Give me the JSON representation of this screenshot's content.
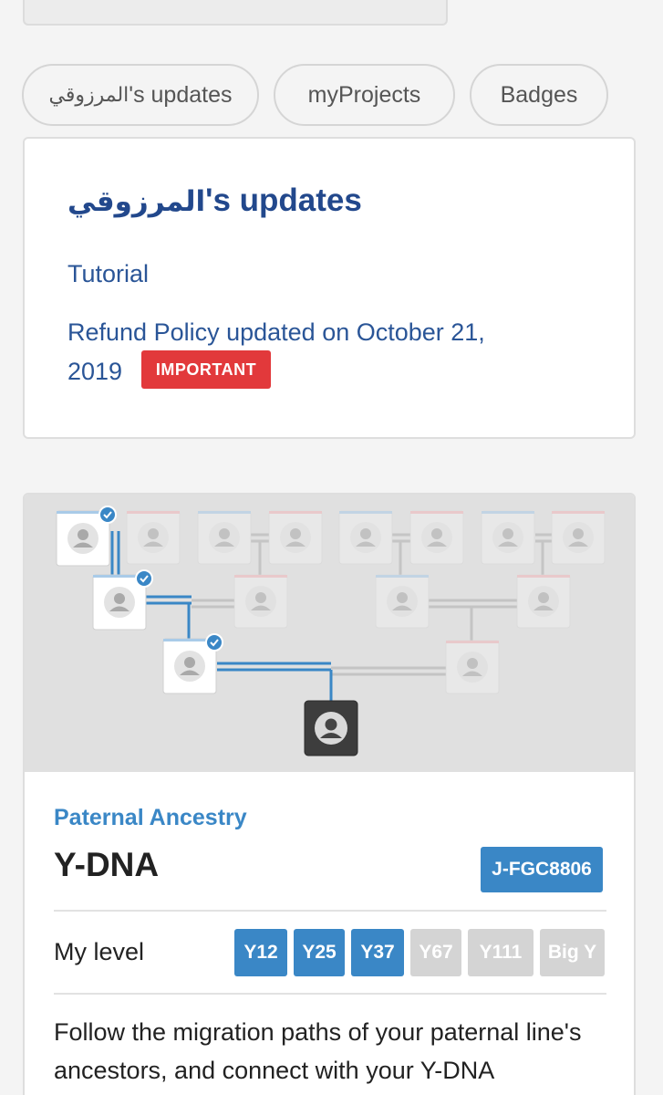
{
  "tabs": [
    {
      "arabic": "المرزوقي",
      "suffix": "'s updates"
    },
    {
      "label": "myProjects"
    },
    {
      "label": "Badges"
    }
  ],
  "updates": {
    "title_arabic": "المرزوقي",
    "title_suffix": "'s updates",
    "tutorial": "Tutorial",
    "refund_text": "Refund Policy updated on October 21, 2019",
    "important_badge": "IMPORTANT"
  },
  "ydna": {
    "category": "Paternal Ancestry",
    "title": "Y-DNA",
    "haplogroup": "J-FGC8806",
    "level_label": "My level",
    "levels": [
      {
        "label": "Y12",
        "achieved": true
      },
      {
        "label": "Y25",
        "achieved": true
      },
      {
        "label": "Y37",
        "achieved": true
      },
      {
        "label": "Y67",
        "achieved": false
      },
      {
        "label": "Y111",
        "achieved": false
      },
      {
        "label": "Big Y",
        "achieved": false
      }
    ],
    "description": "Follow the migration paths of your paternal line's ancestors, and connect with your Y-DNA"
  },
  "colors": {
    "accent": "#3a87c6",
    "link": "#2a5597",
    "important": "#e2393b",
    "inactive_level": "#d4d4d4"
  },
  "icons": [
    "person-icon",
    "check-badge-icon"
  ]
}
